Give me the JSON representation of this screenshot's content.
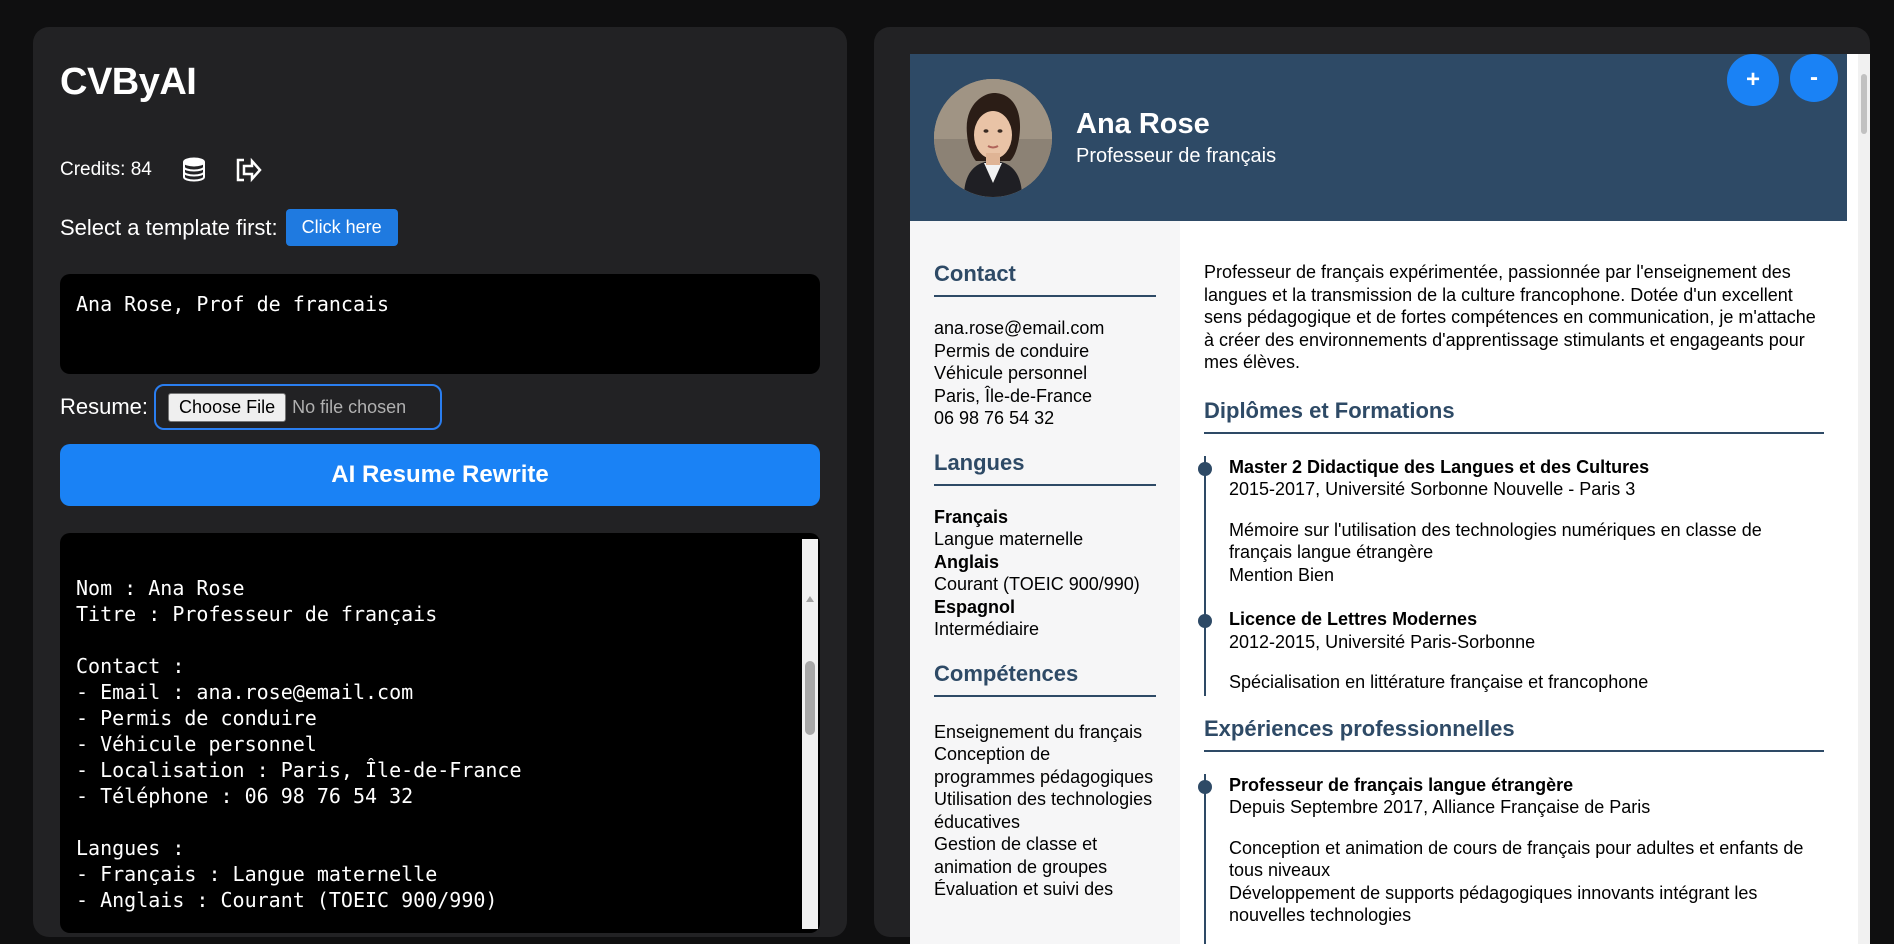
{
  "app": {
    "title": "CVByAI"
  },
  "credits": {
    "label": "Credits: 84"
  },
  "template": {
    "label": "Select a template first:",
    "button": "Click here"
  },
  "prompt": {
    "value": "Ana Rose, Prof de francais"
  },
  "resume_upload": {
    "label": "Resume:",
    "choose_button": "Choose File",
    "status": "No file chosen"
  },
  "rewrite_button": "AI Resume Rewrite",
  "output_text": "Nom : Ana Rose\nTitre : Professeur de français\n\nContact :\n- Email : ana.rose@email.com\n- Permis de conduire\n- Véhicule personnel\n- Localisation : Paris, Île-de-France\n- Téléphone : 06 98 76 54 32\n\nLangues :\n- Français : Langue maternelle\n- Anglais : Courant (TOEIC 900/990)",
  "zoom": {
    "plus": "+",
    "minus": "-"
  },
  "cv": {
    "name": "Ana Rose",
    "title": "Professeur de français",
    "contact": {
      "heading": "Contact",
      "email": "ana.rose@email.com",
      "license": "Permis de conduire",
      "vehicle": "Véhicule personnel",
      "location": "Paris, Île-de-France",
      "phone": "06 98 76 54 32"
    },
    "languages": {
      "heading": "Langues",
      "items": [
        {
          "name": "Français",
          "level": "Langue maternelle"
        },
        {
          "name": "Anglais",
          "level": "Courant (TOEIC 900/990)"
        },
        {
          "name": "Espagnol",
          "level": "Intermédiaire"
        }
      ]
    },
    "skills": {
      "heading": "Compétences",
      "items": [
        "Enseignement du français",
        "Conception de programmes pédagogiques",
        "Utilisation des technologies éducatives",
        "Gestion de classe et animation de groupes",
        "Évaluation et suivi des"
      ]
    },
    "summary": "Professeur de français expérimentée, passionnée par l'enseignement des langues et la transmission de la culture francophone. Dotée d'un excellent sens pédagogique et de fortes compétences en communication, je m'attache à créer des environnements d'apprentissage stimulants et engageants pour mes élèves.",
    "education": {
      "heading": "Diplômes et Formations",
      "items": [
        {
          "title": "Master 2 Didactique des Langues et des Cultures",
          "meta": "2015-2017, Université Sorbonne Nouvelle - Paris 3",
          "desc1": "Mémoire sur l'utilisation des technologies numériques en classe de français langue étrangère",
          "desc2": "Mention Bien"
        },
        {
          "title": "Licence de Lettres Modernes",
          "meta": "2012-2015, Université Paris-Sorbonne",
          "desc1": "Spécialisation en littérature française et francophone",
          "desc2": ""
        }
      ]
    },
    "experience": {
      "heading": "Expériences professionnelles",
      "items": [
        {
          "title": "Professeur de français langue étrangère",
          "meta": "Depuis Septembre 2017, Alliance Française de Paris",
          "desc1": "Conception et animation de cours de français pour adultes et enfants de tous niveaux",
          "desc2": "Développement de supports pédagogiques innovants intégrant les nouvelles technologies"
        }
      ]
    }
  }
}
